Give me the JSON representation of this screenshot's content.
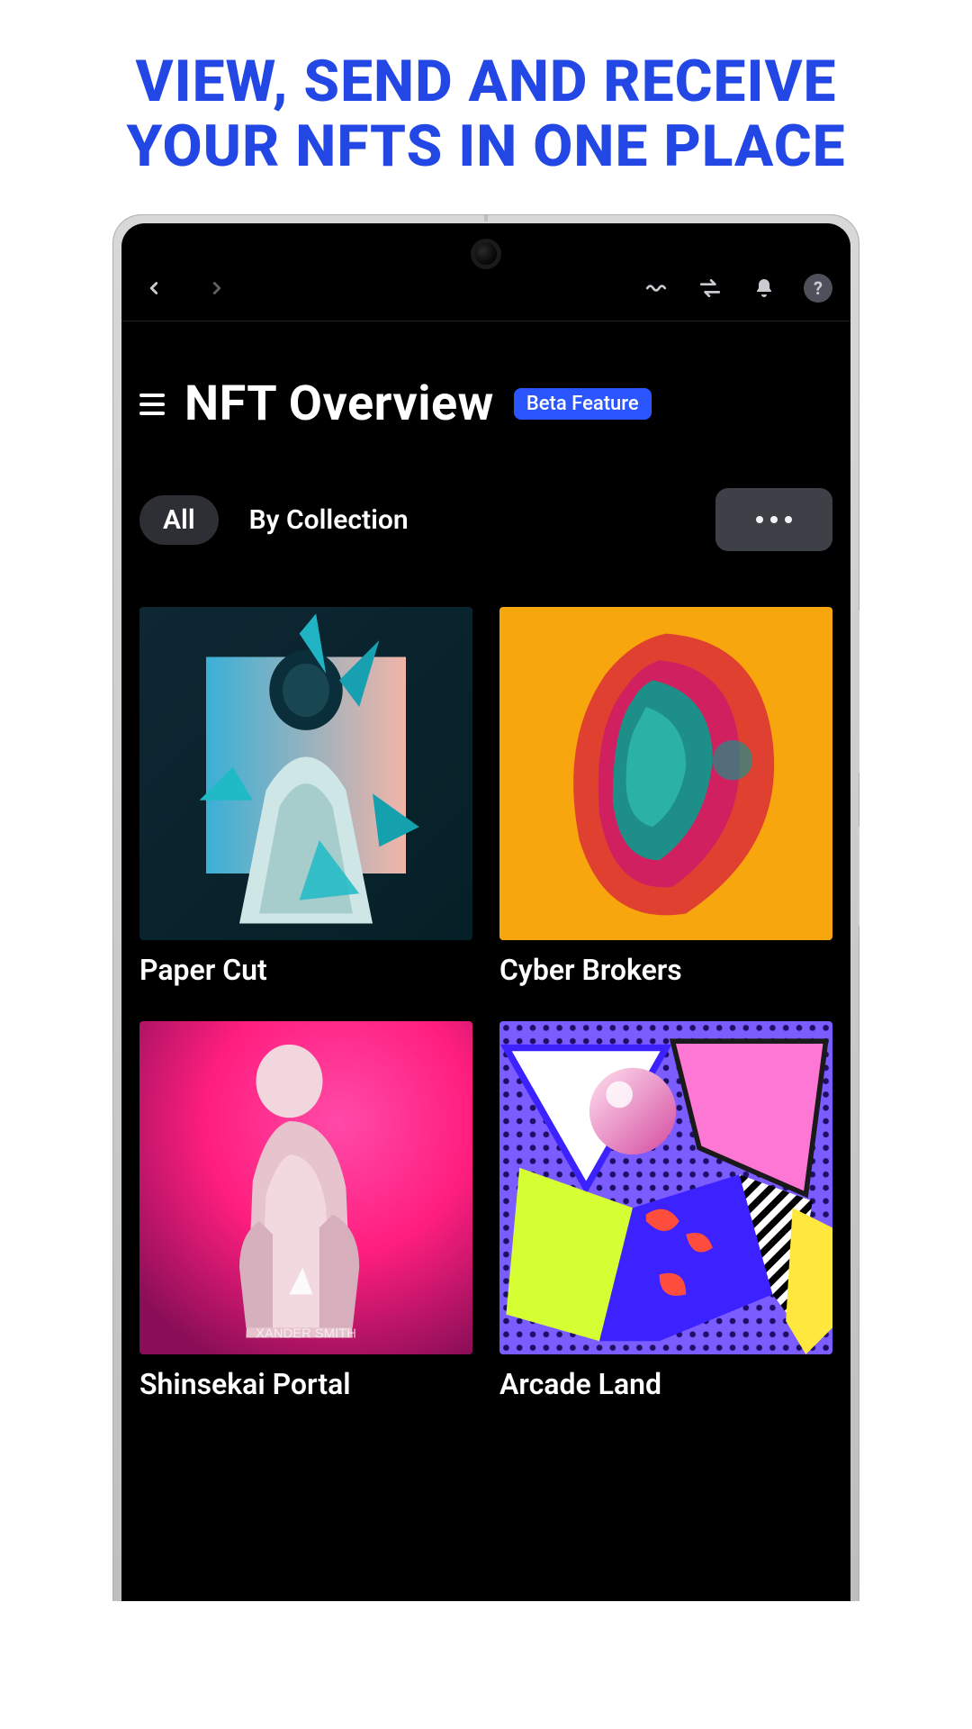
{
  "hero_text": "VIEW, SEND AND RECEIVE YOUR NFTS IN ONE PLACE",
  "colors": {
    "accent": "#2247e5"
  },
  "topbar": {
    "back_icon": "chevron-left",
    "forward_icon": "chevron-right",
    "icons": [
      "waves",
      "swap",
      "bell",
      "help"
    ]
  },
  "page": {
    "title": "NFT Overview",
    "badge": "Beta Feature"
  },
  "filters": {
    "active": "All",
    "inactive": "By Collection"
  },
  "nfts": [
    {
      "name": "Paper Cut",
      "icon": "art-astronaut-crystals"
    },
    {
      "name": "Cyber Brokers",
      "icon": "art-portrait-thermal"
    },
    {
      "name": "Shinsekai Portal",
      "icon": "art-cyborg-pink"
    },
    {
      "name": "Arcade Land",
      "icon": "art-geometric-retro"
    }
  ]
}
